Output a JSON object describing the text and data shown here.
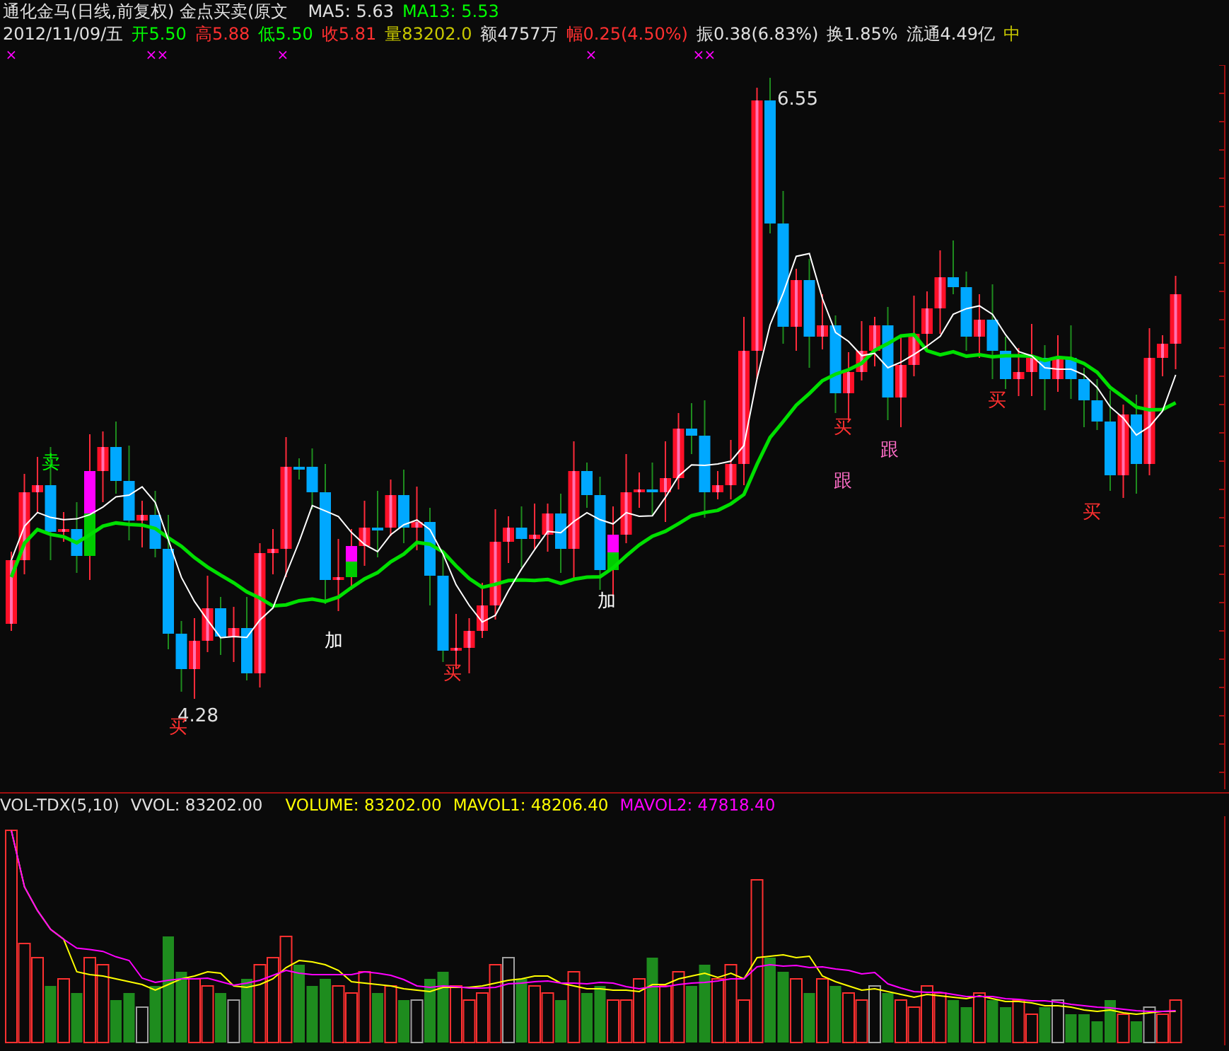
{
  "header": {
    "line1": [
      {
        "text": "通化金马(日线,前复权) 金点买卖(原文",
        "color": "#e0e0e0"
      },
      {
        "text": "MA5: 5.63",
        "color": "#e0e0e0"
      },
      {
        "text": "MA13: 5.53",
        "color": "#00ff00"
      }
    ],
    "line2": [
      {
        "text": "2012/11/09/五",
        "color": "#e0e0e0"
      },
      {
        "text": "开5.50",
        "color": "#00ff00"
      },
      {
        "text": "高5.88",
        "color": "#ff3030"
      },
      {
        "text": "低5.50",
        "color": "#00ff00"
      },
      {
        "text": "收5.81",
        "color": "#ff3030"
      },
      {
        "text": "量83202.0",
        "color": "#c8c800"
      },
      {
        "text": "额4757万",
        "color": "#e0e0e0"
      },
      {
        "text": "幅0.25(4.50%)",
        "color": "#ff3030"
      },
      {
        "text": "振0.38(6.83%)",
        "color": "#e0e0e0"
      },
      {
        "text": "换1.85%",
        "color": "#e0e0e0"
      },
      {
        "text": "流通4.49亿",
        "color": "#e0e0e0"
      },
      {
        "text": "中",
        "color": "#c8c800"
      }
    ]
  },
  "markers": [
    "×",
    "×",
    "×",
    "×",
    "×",
    "×",
    "×"
  ],
  "annotations": [
    {
      "text": "卖",
      "color": "#00ff00"
    },
    {
      "text": "4.28",
      "color": "#e0e0e0"
    },
    {
      "text": "买",
      "color": "#ff3030"
    },
    {
      "text": "加",
      "color": "#ffffff"
    },
    {
      "text": "买",
      "color": "#ff3030"
    },
    {
      "text": "加",
      "color": "#ffffff"
    },
    {
      "text": "6.55",
      "color": "#e0e0e0"
    },
    {
      "text": "买",
      "color": "#ff3030"
    },
    {
      "text": "跟",
      "color": "#ff6ec8"
    },
    {
      "text": "跟",
      "color": "#ff6ec8"
    },
    {
      "text": "买",
      "color": "#ff3030"
    },
    {
      "text": "买",
      "color": "#ff3030"
    }
  ],
  "volume_header": [
    {
      "text": "VOL-TDX(5,10)",
      "color": "#e0e0e0"
    },
    {
      "text": "VVOL: 83202.00",
      "color": "#e0e0e0"
    },
    {
      "text": "VOLUME: 83202.00",
      "color": "#ffff00"
    },
    {
      "text": "MAVOL1: 48206.40",
      "color": "#ffff00"
    },
    {
      "text": "MAVOL2: 47818.40",
      "color": "#ff00ff"
    }
  ]
}
